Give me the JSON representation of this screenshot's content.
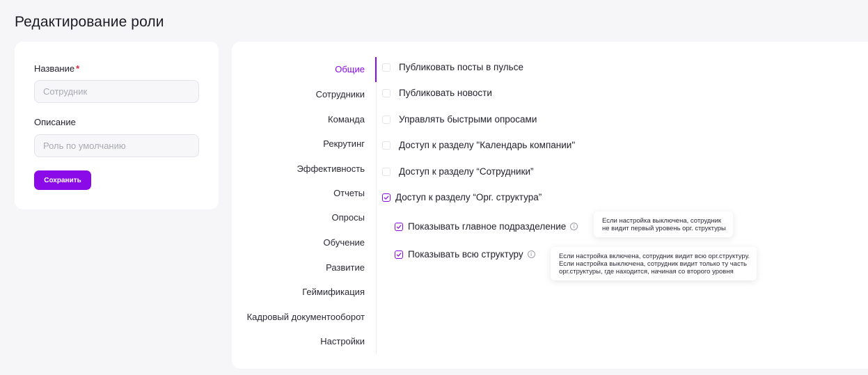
{
  "page": {
    "title": "Редактирование роли"
  },
  "form": {
    "name_label": "Название",
    "name_required": "*",
    "name_placeholder": "Сотрудник",
    "description_label": "Описание",
    "description_placeholder": "Роль по умолчанию",
    "save_label": "Сохранить"
  },
  "tabs": [
    {
      "label": "Общие",
      "active": true
    },
    {
      "label": "Сотрудники"
    },
    {
      "label": "Команда"
    },
    {
      "label": "Рекрутинг"
    },
    {
      "label": "Эффективность"
    },
    {
      "label": "Отчеты"
    },
    {
      "label": "Опросы"
    },
    {
      "label": "Обучение"
    },
    {
      "label": "Развитие"
    },
    {
      "label": "Геймификация"
    },
    {
      "label": "Кадровый документооборот"
    },
    {
      "label": "Настройки"
    }
  ],
  "permissions": [
    {
      "label": "Публиковать посты в пульсе",
      "checked": false
    },
    {
      "label": "Публиковать новости",
      "checked": false
    },
    {
      "label": "Управлять быстрыми опросами",
      "checked": false
    },
    {
      "label": "Доступ к разделу \"Календарь компании\"",
      "checked": false
    },
    {
      "label": "Доступ к разделу “Сотрудники”",
      "checked": false
    },
    {
      "label": "Доступ к разделу “Орг. структура”",
      "checked": true
    },
    {
      "label": "Показывать главное подразделение",
      "checked": true
    },
    {
      "label": "Показывать всю структуру",
      "checked": true
    }
  ],
  "tooltips": {
    "main_division": [
      "Если настройка выключена, сотрудник",
      "не видит первый уровень орг. структуры"
    ],
    "full_structure": [
      "Если настройка включена, сотрудник видит всю орг.структуру.",
      "Если настройка выключена, сотрудник видит только ту часть",
      "орг.структуры, где находится, начиная со второго уровня"
    ]
  },
  "colors": {
    "accent": "#8a0be8",
    "background": "#f6f6f8",
    "required": "#e0243a"
  },
  "icons": {
    "info": "info-icon",
    "check": "check-icon"
  }
}
